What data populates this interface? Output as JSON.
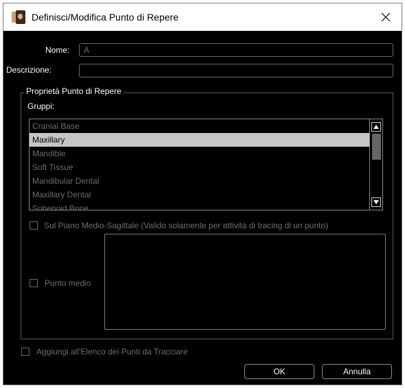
{
  "window": {
    "title": "Definisci/Modifica Punto di Repere"
  },
  "form": {
    "name_label": "Nome:",
    "name_value": "A",
    "description_label": "Descrizione:",
    "description_value": ""
  },
  "properties": {
    "group_title": "Proprietà Punto di Repere",
    "groups_label": "Gruppi:",
    "groups": [
      {
        "label": "Cranial Base",
        "selected": false
      },
      {
        "label": "Maxillary",
        "selected": true
      },
      {
        "label": "Mandible",
        "selected": false
      },
      {
        "label": "Soft Tissue",
        "selected": false
      },
      {
        "label": "Mandibular Dental",
        "selected": false
      },
      {
        "label": "Maxillary Dental",
        "selected": false
      },
      {
        "label": "Sphenoid Bone",
        "selected": false
      }
    ],
    "midsagittal_label": "Sul Piano Medio-Sagittale (Valido solamente per attività di tracing di un punto)",
    "midsagittal_checked": false,
    "midpoint_label": "Punto medio",
    "midpoint_checked": false
  },
  "footer": {
    "add_to_trace_label": "Aggiungi all'Elenco dei Punti da Tracciare",
    "add_to_trace_checked": false,
    "ok_label": "OK",
    "cancel_label": "Annulla"
  },
  "icons": {
    "app": "app-icon",
    "close": "close-icon",
    "scroll_up": "arrow-up-icon",
    "scroll_down": "arrow-down-icon"
  }
}
